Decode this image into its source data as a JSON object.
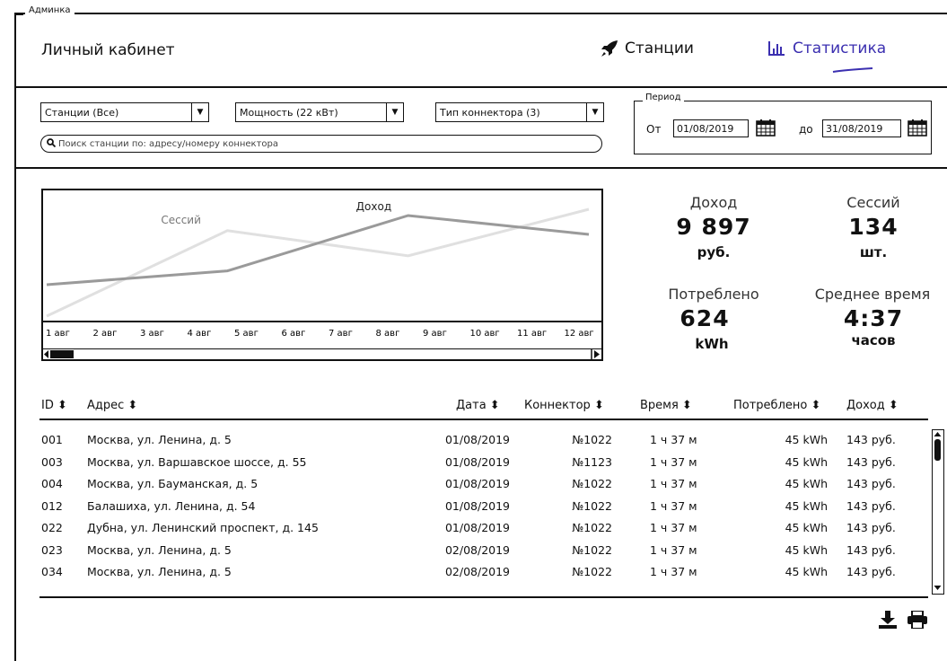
{
  "frame_title": "Админка",
  "header": {
    "title": "Личный кабинет",
    "nav": [
      {
        "label": "Станции",
        "icon": "rocket-icon"
      },
      {
        "label": "Статистика",
        "icon": "bar-chart-icon"
      }
    ]
  },
  "filters": {
    "stations": "Станции (Все)",
    "power": "Мощность (22 кВт)",
    "connector": "Тип коннектора (3)",
    "search_placeholder": "Поиск станции по: адресу/номеру коннектора"
  },
  "period": {
    "title": "Период",
    "from_label": "От",
    "from": "01/08/2019",
    "to_label": "до",
    "to": "31/08/2019"
  },
  "chart_data": {
    "type": "line",
    "categories": [
      "1 авг",
      "2 авг",
      "3 авг",
      "4 авг",
      "5 авг",
      "6 авг",
      "7 авг",
      "8 авг",
      "9 авг",
      "10 авг",
      "11 авг",
      "12 авг"
    ],
    "series": [
      {
        "name": "Сессий",
        "color": "#e0e0e0",
        "x": [
          0,
          4,
          8,
          12
        ],
        "values": [
          0,
          0.68,
          0.48,
          0.85
        ]
      },
      {
        "name": "Доход",
        "color": "#9a9a9a",
        "x": [
          0,
          4,
          8,
          12
        ],
        "values": [
          0.25,
          0.36,
          0.8,
          0.65
        ]
      }
    ]
  },
  "stats": {
    "revenue": {
      "label": "Доход",
      "value": "9 897",
      "unit": "руб."
    },
    "sessions": {
      "label": "Сессий",
      "value": "134",
      "unit": "шт."
    },
    "consumed": {
      "label": "Потреблено",
      "value": "624",
      "unit": "kWh"
    },
    "avg_time": {
      "label": "Среднее время",
      "value": "4:37",
      "unit": "часов"
    }
  },
  "table": {
    "columns": [
      "ID ⬍",
      "Адрес ⬍",
      "Дата ⬍",
      "Коннектор ⬍",
      "Время ⬍",
      "Потреблено ⬍",
      "Доход ⬍"
    ],
    "rows": [
      {
        "id": "001",
        "address": "Москва, ул. Ленина, д. 5",
        "date": "01/08/2019",
        "connector": "№1022",
        "time": "1 ч 37 м",
        "consumed": "45 kWh",
        "revenue": "143 руб."
      },
      {
        "id": "003",
        "address": "Москва, ул. Варшавское шоссе, д. 55",
        "date": "01/08/2019",
        "connector": "№1123",
        "time": "1 ч 37 м",
        "consumed": "45 kWh",
        "revenue": "143 руб."
      },
      {
        "id": "004",
        "address": "Москва, ул. Бауманская, д. 5",
        "date": "01/08/2019",
        "connector": "№1022",
        "time": "1 ч 37 м",
        "consumed": "45 kWh",
        "revenue": "143 руб."
      },
      {
        "id": "012",
        "address": "Балашиха, ул. Ленина, д. 54",
        "date": "01/08/2019",
        "connector": "№1022",
        "time": "1 ч 37 м",
        "consumed": "45 kWh",
        "revenue": "143 руб."
      },
      {
        "id": "022",
        "address": "Дубна, ул. Ленинский проспект, д. 145",
        "date": "01/08/2019",
        "connector": "№1022",
        "time": "1 ч 37 м",
        "consumed": "45 kWh",
        "revenue": "143 руб."
      },
      {
        "id": "023",
        "address": "Москва, ул. Ленина, д. 5",
        "date": "02/08/2019",
        "connector": "№1022",
        "time": "1 ч 37 м",
        "consumed": "45 kWh",
        "revenue": "143 руб."
      },
      {
        "id": "034",
        "address": "Москва, ул. Ленина, д. 5",
        "date": "02/08/2019",
        "connector": "№1022",
        "time": "1 ч 37 м",
        "consumed": "45 kWh",
        "revenue": "143 руб."
      }
    ]
  },
  "actions": {
    "download_icon": "download-icon",
    "print_icon": "print-icon"
  },
  "colors": {
    "accent": "#3b2fb0"
  }
}
